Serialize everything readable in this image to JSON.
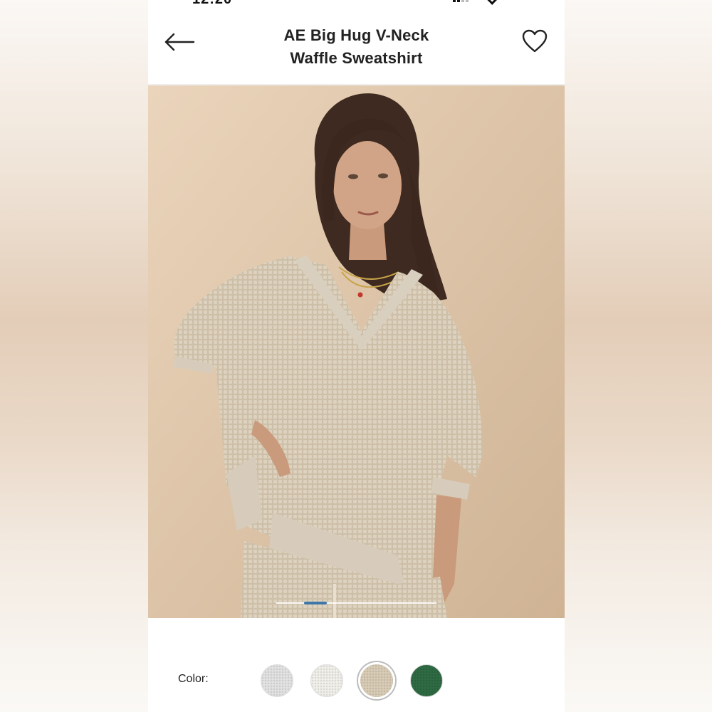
{
  "status_bar": {
    "time": "12:20"
  },
  "header": {
    "back_icon": "arrow-left-icon",
    "title_line1": "AE Big Hug V-Neck",
    "title_line2": "Waffle Sweatshirt",
    "favorite_icon": "heart-outline-icon"
  },
  "gallery": {
    "current_index_fraction": 0.2
  },
  "colors": {
    "label": "Color:",
    "swatches": [
      {
        "color": "#e2e2e2",
        "selected": false
      },
      {
        "color": "#f1f0ea",
        "selected": false
      },
      {
        "color": "#d8ccb6",
        "selected": true
      },
      {
        "color": "#2e6b43",
        "selected": false
      }
    ]
  },
  "theme": {
    "accent": "#3f78a8",
    "text": "#222222",
    "background": "#ffffff"
  }
}
